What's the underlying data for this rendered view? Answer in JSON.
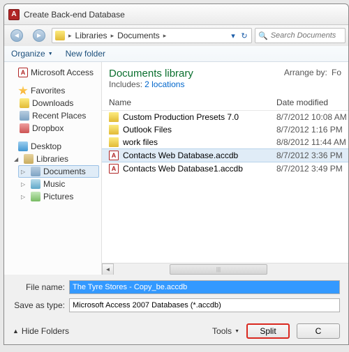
{
  "titlebar": {
    "appInitial": "A",
    "title": "Create Back-end Database"
  },
  "breadcrumb": {
    "items": [
      "Libraries",
      "Documents"
    ],
    "searchPlaceholder": "Search Documents"
  },
  "toolbar": {
    "organize": "Organize",
    "newFolder": "New folder"
  },
  "sidebar": {
    "appItem": "Microsoft Access",
    "favorites": {
      "label": "Favorites",
      "items": [
        "Downloads",
        "Recent Places",
        "Dropbox"
      ]
    },
    "desktop": "Desktop",
    "libraries": {
      "label": "Libraries",
      "items": [
        "Documents",
        "Music",
        "Pictures"
      ]
    }
  },
  "libHeader": {
    "title": "Documents library",
    "includesPre": "Includes:",
    "includesLink": "2 locations",
    "arrangePre": "Arrange by:",
    "arrangeVal": "Fo"
  },
  "columns": {
    "name": "Name",
    "date": "Date modified"
  },
  "files": [
    {
      "type": "folder",
      "name": "Custom Production Presets 7.0",
      "date": "8/7/2012 10:08 AM"
    },
    {
      "type": "folder",
      "name": "Outlook Files",
      "date": "8/7/2012 1:16 PM"
    },
    {
      "type": "folder",
      "name": "work files",
      "date": "8/8/2012 11:44 AM"
    },
    {
      "type": "accdb",
      "name": "Contacts Web Database.accdb",
      "date": "8/7/2012 3:36 PM",
      "selected": true
    },
    {
      "type": "accdb",
      "name": "Contacts Web Database1.accdb",
      "date": "8/7/2012 3:49 PM"
    }
  ],
  "form": {
    "fileNameLabel": "File name:",
    "fileNameValue": "The Tyre Stores - Copy_be.accdb",
    "saveTypeLabel": "Save as type:",
    "saveTypeValue": "Microsoft Access 2007 Databases (*.accdb)"
  },
  "footer": {
    "hideFolders": "Hide Folders",
    "tools": "Tools",
    "primary": "Split",
    "cancel": "C"
  }
}
